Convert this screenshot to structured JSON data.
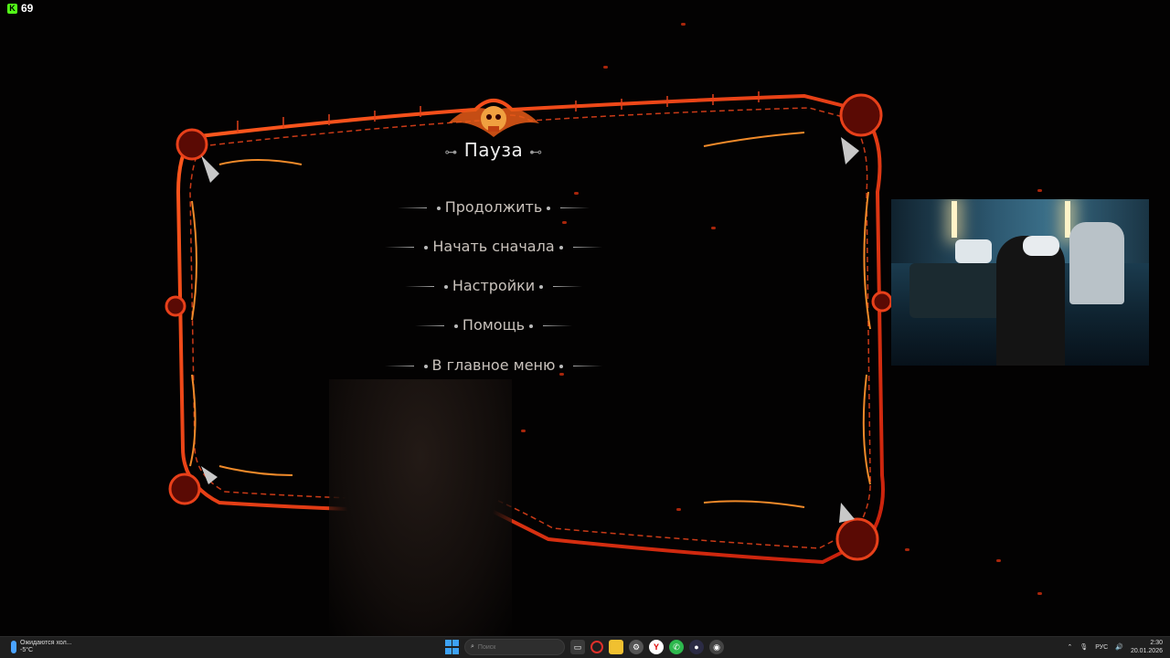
{
  "viewer_count": "69",
  "pause_menu": {
    "title": "Пауза",
    "items": [
      {
        "label": "Продолжить"
      },
      {
        "label": "Начать сначала"
      },
      {
        "label": "Настройки"
      },
      {
        "label": "Помощь"
      },
      {
        "label": "В главное меню"
      }
    ]
  },
  "taskbar": {
    "weather_status": "Ожидаются хол...",
    "temperature": "-5°C",
    "search_placeholder": "Поиск",
    "language": "РУС",
    "time": "2:30",
    "date": "20.01.2026"
  },
  "colors": {
    "frame_primary": "#e0401a",
    "frame_accent": "#f08a2a",
    "menu_text": "#c9c2bc",
    "ember": "#d2300e",
    "taskbar_bg": "#1f1f1f"
  }
}
